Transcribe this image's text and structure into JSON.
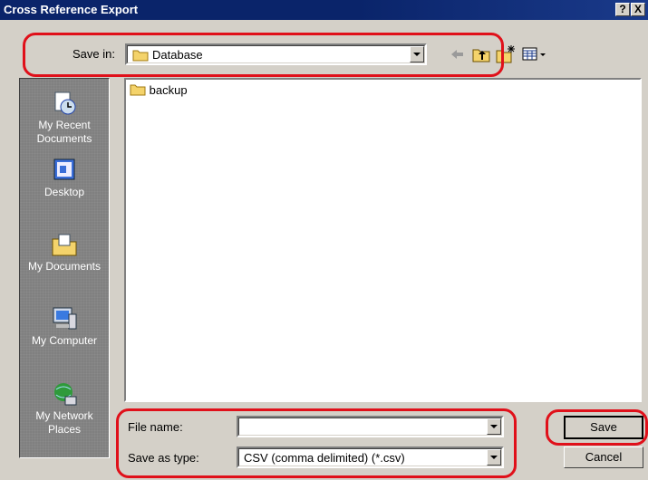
{
  "window": {
    "title": "Cross Reference Export",
    "help_glyph": "?",
    "close_glyph": "X"
  },
  "toolbar": {
    "save_in_label": "Save in:",
    "save_in_value": "Database",
    "icons": [
      "back-arrow-icon",
      "up-one-level-icon",
      "create-new-folder-icon",
      "view-menu-icon"
    ]
  },
  "places": [
    {
      "name": "my-recent-documents",
      "label": "My Recent Documents"
    },
    {
      "name": "desktop",
      "label": "Desktop"
    },
    {
      "name": "my-documents",
      "label": "My Documents"
    },
    {
      "name": "my-computer",
      "label": "My Computer"
    },
    {
      "name": "my-network-places",
      "label": "My Network Places"
    }
  ],
  "files": [
    {
      "name": "backup",
      "type": "folder"
    }
  ],
  "form": {
    "file_name_label": "File name:",
    "file_name_value": "",
    "save_as_type_label": "Save as type:",
    "save_as_type_value": "CSV (comma delimited) (*.csv)"
  },
  "buttons": {
    "save": "Save",
    "cancel": "Cancel"
  },
  "annotation_color": "#e0101a"
}
